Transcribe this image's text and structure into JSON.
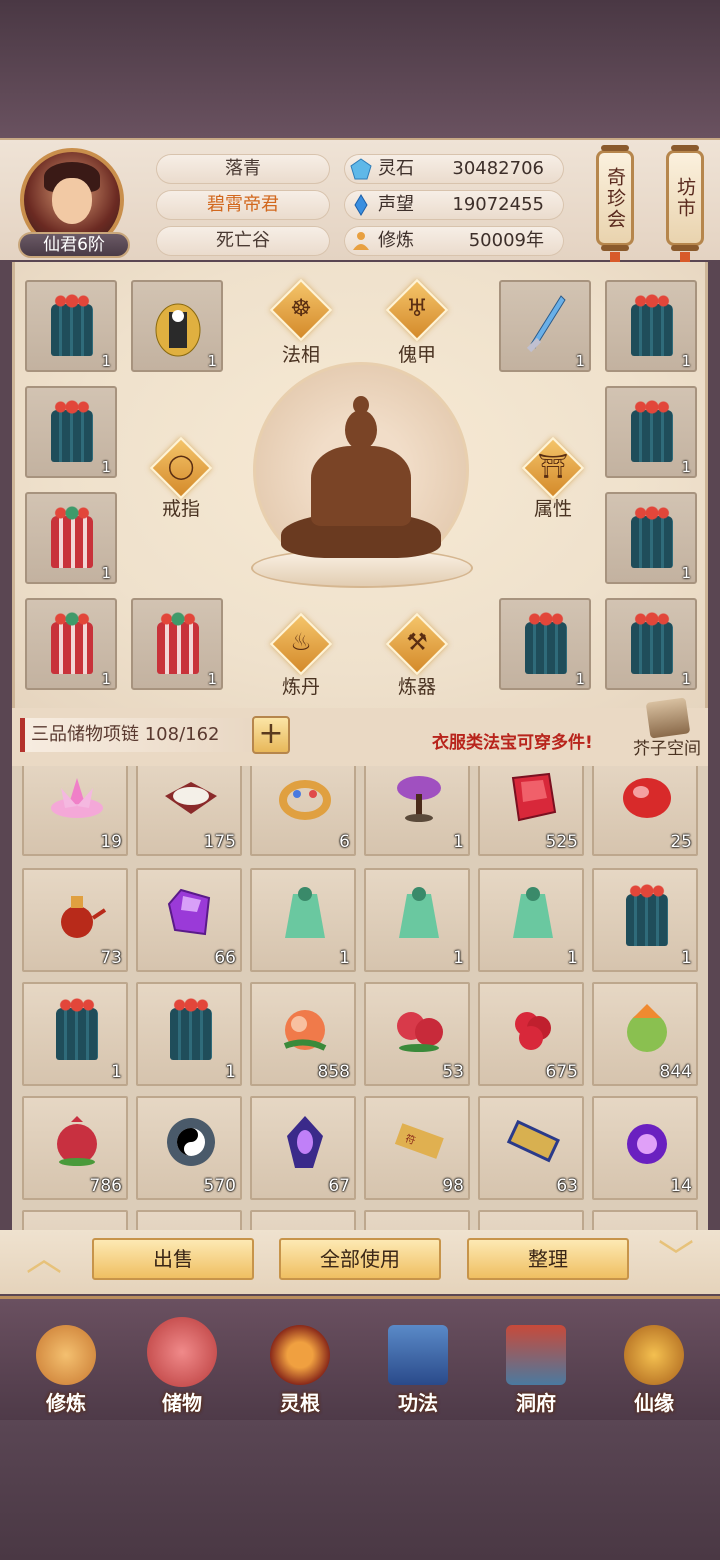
{
  "header": {
    "player_name": "落青",
    "title": "碧霄帝君",
    "location": "死亡谷",
    "rank": "仙君6阶",
    "stats": [
      {
        "label": "灵石",
        "value": "30482706",
        "icon": "spirit-stone-icon",
        "color": "#5fb8e8"
      },
      {
        "label": "声望",
        "value": "19072455",
        "icon": "prestige-crystal-icon",
        "color": "#3a8fe0"
      },
      {
        "label": "修炼",
        "value": "50009年",
        "icon": "meditation-icon",
        "color": "#e8a040"
      }
    ],
    "buttons": {
      "treasure_house": "奇珍会",
      "market": "坊市"
    }
  },
  "equipment": {
    "slots_left": [
      "1",
      "1",
      "1",
      "1",
      "1",
      "1"
    ],
    "slots_right": [
      "1",
      "1",
      "1",
      "1",
      "1",
      "1"
    ],
    "functions": {
      "dharma_form": "法相",
      "puppet_armor": "傀甲",
      "ring": "戒指",
      "attributes": "属性",
      "alchemy": "炼丹",
      "refining": "炼器"
    }
  },
  "bag": {
    "container_name": "三品储物项链",
    "capacity": "108/162",
    "plus": "+",
    "hint": "衣服类法宝可穿多件!",
    "space_label": "芥子空间"
  },
  "inventory": {
    "rows": [
      [
        {
          "icon": "pink-lotus-icon",
          "count": "19"
        },
        {
          "icon": "rice-box-icon",
          "count": "175"
        },
        {
          "icon": "gold-ring-icon",
          "count": "6"
        },
        {
          "icon": "purple-bonsai-icon",
          "count": "1"
        },
        {
          "icon": "red-crystal-icon",
          "count": "525"
        },
        {
          "icon": "red-gem-icon",
          "count": "25"
        }
      ],
      [
        {
          "icon": "wine-pot-icon",
          "count": "73"
        },
        {
          "icon": "purple-gem-icon",
          "count": "66"
        },
        {
          "icon": "jade-robe-icon",
          "count": "1"
        },
        {
          "icon": "jade-robe-icon",
          "count": "1"
        },
        {
          "icon": "jade-robe-icon",
          "count": "1"
        },
        {
          "icon": "blue-robe-icon",
          "count": "1"
        }
      ],
      [
        {
          "icon": "blue-robe-icon",
          "count": "1"
        },
        {
          "icon": "blue-robe-icon",
          "count": "1"
        },
        {
          "icon": "peach-icon",
          "count": "858"
        },
        {
          "icon": "red-fruit-icon",
          "count": "53"
        },
        {
          "icon": "raspberry-icon",
          "count": "675"
        },
        {
          "icon": "green-fruit-icon",
          "count": "844"
        }
      ],
      [
        {
          "icon": "pomegranate-icon",
          "count": "786"
        },
        {
          "icon": "bagua-compass-icon",
          "count": "570"
        },
        {
          "icon": "purple-crystal-icon",
          "count": "67"
        },
        {
          "icon": "talisman-scroll-icon",
          "count": "98"
        },
        {
          "icon": "blue-talisman-icon",
          "count": "63"
        },
        {
          "icon": "purple-flame-icon",
          "count": "14"
        }
      ]
    ]
  },
  "actions": {
    "sell": "出售",
    "use_all": "全部使用",
    "sort": "整理"
  },
  "nav": [
    {
      "label": "修炼",
      "icon": "cultivation-icon"
    },
    {
      "label": "储物",
      "icon": "storage-bag-icon"
    },
    {
      "label": "灵根",
      "icon": "spirit-root-icon"
    },
    {
      "label": "功法",
      "icon": "technique-book-icon"
    },
    {
      "label": "洞府",
      "icon": "cave-mansion-icon"
    },
    {
      "label": "仙缘",
      "icon": "immortal-fate-icon"
    }
  ]
}
